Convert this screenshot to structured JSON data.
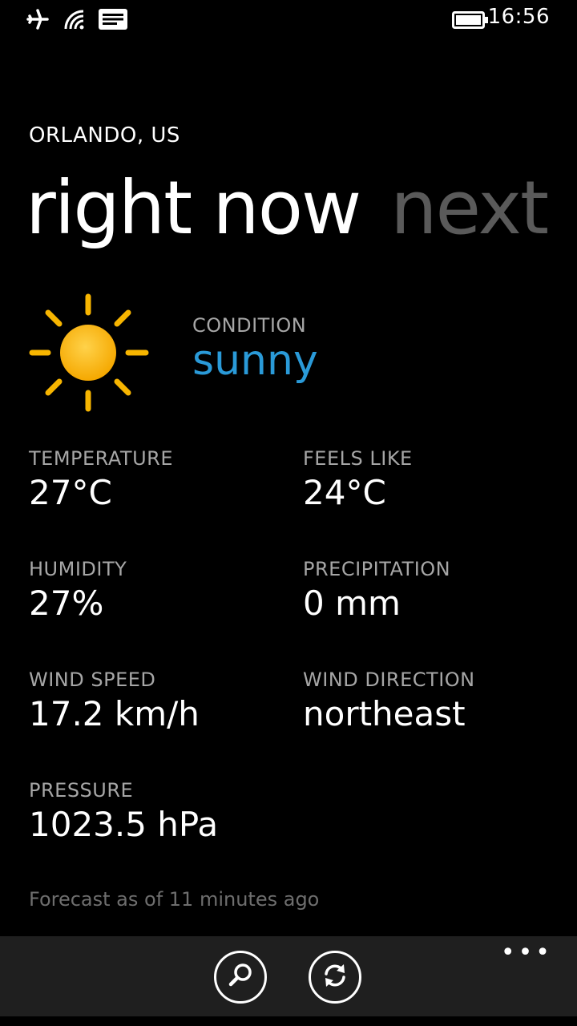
{
  "status": {
    "time": "16:56",
    "icons": [
      "airplane-icon",
      "wifi-icon",
      "message-icon",
      "battery-icon"
    ]
  },
  "location": {
    "city": "ORLANDO, US"
  },
  "pivot": {
    "active": "right now",
    "next": "next"
  },
  "condition": {
    "label": "CONDITION",
    "value": "sunny",
    "icon": "sun-icon",
    "color": "#2a9ad8"
  },
  "fields": {
    "temperature": {
      "label": "TEMPERATURE",
      "value": "27°C"
    },
    "feels_like": {
      "label": "FEELS LIKE",
      "value": "24°C"
    },
    "humidity": {
      "label": "HUMIDITY",
      "value": "27%"
    },
    "precipitation": {
      "label": "PRECIPITATION",
      "value": "0 mm"
    },
    "wind_speed": {
      "label": "WIND SPEED",
      "value": "17.2 km/h"
    },
    "wind_direction": {
      "label": "WIND DIRECTION",
      "value": "northeast"
    },
    "pressure": {
      "label": "PRESSURE",
      "value": "1023.5 hPa"
    }
  },
  "footer": {
    "note": "Forecast as of 11 minutes ago"
  },
  "app_bar": {
    "more": "•••",
    "buttons": [
      "search-icon",
      "refresh-icon"
    ]
  }
}
